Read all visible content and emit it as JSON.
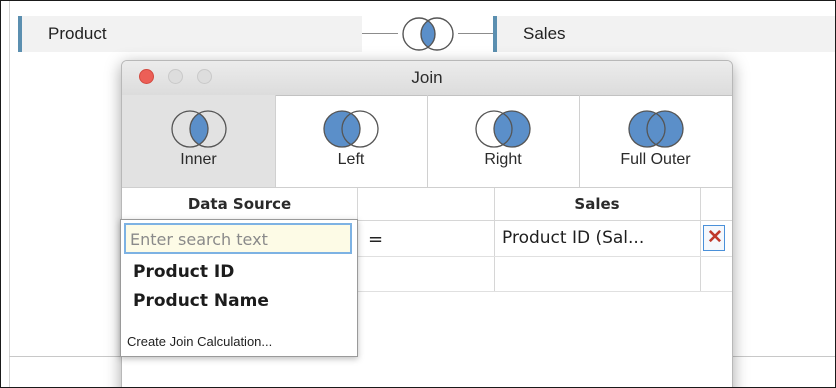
{
  "canvas": {
    "left_table": "Product",
    "right_table": "Sales"
  },
  "dialog": {
    "title": "Join",
    "join_types": [
      {
        "label": "Inner",
        "selected": true,
        "icon": "inner-join-venn-icon"
      },
      {
        "label": "Left",
        "selected": false,
        "icon": "left-join-venn-icon"
      },
      {
        "label": "Right",
        "selected": false,
        "icon": "right-join-venn-icon"
      },
      {
        "label": "Full Outer",
        "selected": false,
        "icon": "full-outer-join-venn-icon"
      }
    ],
    "clauses": {
      "left_header": "Data Source",
      "right_header": "Sales",
      "operator": "=",
      "right_field": "Product ID (Sal...",
      "delete_icon": "close-icon"
    }
  },
  "picker": {
    "search_placeholder": "Enter search text",
    "options": [
      "Product ID",
      "Product Name"
    ],
    "create_calc": "Create Join Calculation..."
  },
  "colors": {
    "venn_fill": "#5b8fc9",
    "accent_border": "#5b8fb0",
    "close_light": "#ec5f57",
    "delete_x": "#c0392b",
    "search_bg": "#fdfbe6"
  }
}
